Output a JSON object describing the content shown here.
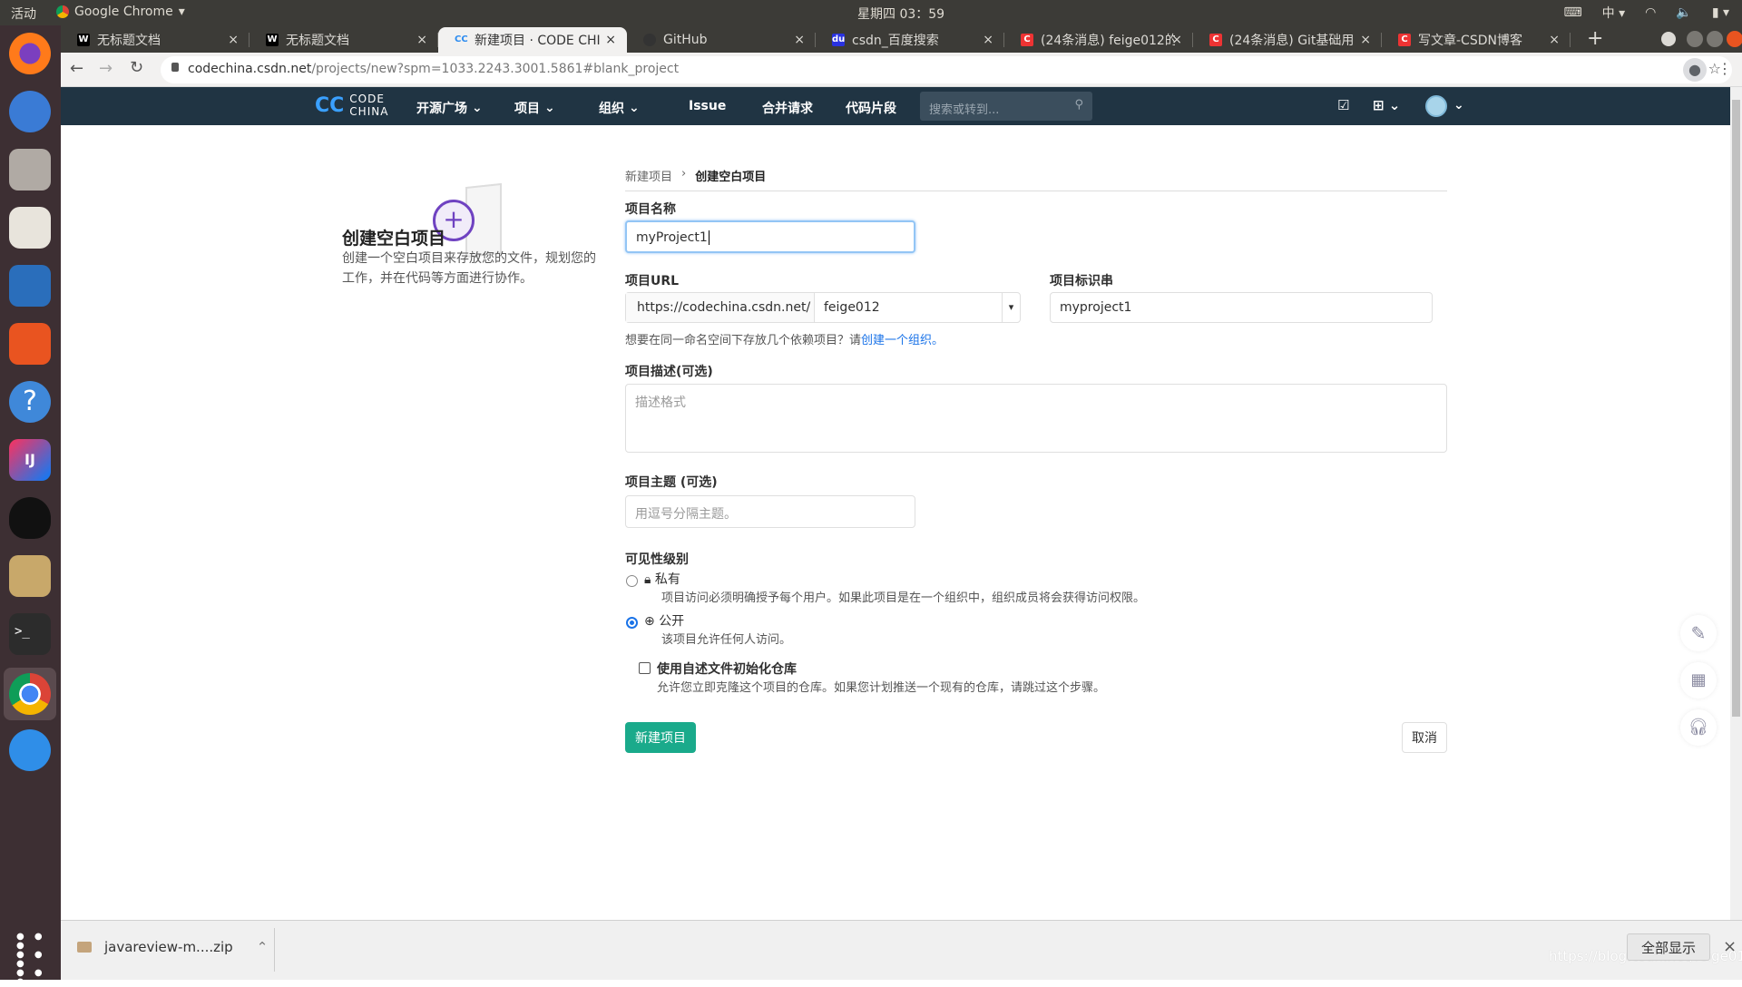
{
  "os": {
    "activities": "活动",
    "app_name": "Google Chrome",
    "clock": "星期四 03：59",
    "ime": "中"
  },
  "tabs": [
    {
      "title": "无标题文档",
      "icon": "webstorm-icon",
      "active": false
    },
    {
      "title": "无标题文档",
      "icon": "webstorm-icon",
      "active": false
    },
    {
      "title": "新建项目 · CODE CHI",
      "icon": "codechina-icon",
      "active": true
    },
    {
      "title": "GitHub",
      "icon": "github-icon",
      "active": false
    },
    {
      "title": "csdn_百度搜索",
      "icon": "baidu-icon",
      "active": false
    },
    {
      "title": "(24条消息) feige012的",
      "icon": "csdn-icon",
      "active": false
    },
    {
      "title": "(24条消息) Git基础用",
      "icon": "csdn-icon",
      "active": false
    },
    {
      "title": "写文章-CSDN博客",
      "icon": "csdn-icon",
      "active": false
    }
  ],
  "address": {
    "host": "codechina.csdn.net",
    "path": "/projects/new?spm=1033.2243.3001.5861#blank_project"
  },
  "navbar": {
    "logo_top": "CODE",
    "logo_bottom": "CHINA",
    "items": [
      "开源广场",
      "项目",
      "组织",
      "Issue",
      "合并请求",
      "代码片段"
    ],
    "search_placeholder": "搜索或转到..."
  },
  "left_panel": {
    "title": "创建空白项目",
    "description": "创建一个空白项目来存放您的文件，规划您的工作，并在代码等方面进行协作。"
  },
  "breadcrumb": {
    "parent": "新建项目",
    "current": "创建空白项目"
  },
  "form": {
    "name_label": "项目名称",
    "name_value": "myProject1",
    "url_label": "项目URL",
    "url_prefix": "https://codechina.csdn.net/",
    "namespace": "feige012",
    "slug_label": "项目标识串",
    "slug_value": "myproject1",
    "namespace_help": "想要在同一命名空间下存放几个依赖项目？请",
    "namespace_help_link": "创建一个组织。",
    "desc_label": "项目描述(可选)",
    "desc_placeholder": "描述格式",
    "topics_label": "项目主题 (可选)",
    "topics_placeholder": "用逗号分隔主题。",
    "visibility_label": "可见性级别",
    "visibility": [
      {
        "label": "私有",
        "help": "项目访问必须明确授予每个用户。如果此项目是在一个组织中，组织成员将会获得访问权限。",
        "selected": false
      },
      {
        "label": "公开",
        "help": "该项目允许任何人访问。",
        "selected": true
      }
    ],
    "readme_label": "使用自述文件初始化仓库",
    "readme_help": "允许您立即克隆这个项目的仓库。如果您计划推送一个现有的仓库，请跳过这个步骤。",
    "readme_checked": false,
    "submit": "新建项目",
    "cancel": "取消"
  },
  "download": {
    "file": "javareview-m....zip",
    "show_all": "全部显示",
    "watermark": "https://blog.csdn.net/feige012"
  },
  "colors": {
    "navbar": "#203443",
    "primary": "#1aaa8b",
    "link": "#1a73e8",
    "accent": "#6f42c1"
  }
}
